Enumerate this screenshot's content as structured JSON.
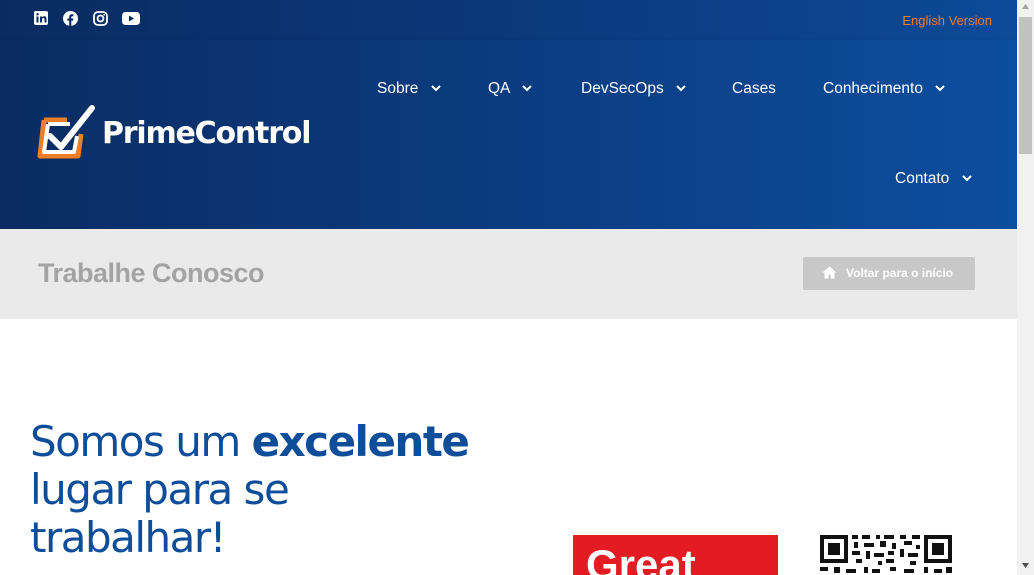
{
  "topbar": {
    "social_icons": [
      "linkedin-icon",
      "facebook-icon",
      "instagram-icon",
      "youtube-icon"
    ],
    "language_link": "English Version"
  },
  "header": {
    "logo_text": "PrimeControl",
    "nav": [
      {
        "label": "Sobre",
        "has_dropdown": true
      },
      {
        "label": "QA",
        "has_dropdown": true
      },
      {
        "label": "DevSecOps",
        "has_dropdown": true
      },
      {
        "label": "Cases",
        "has_dropdown": false
      },
      {
        "label": "Conhecimento",
        "has_dropdown": true
      },
      {
        "label": "Contato",
        "has_dropdown": true
      }
    ]
  },
  "titlebar": {
    "title": "Trabalhe Conosco",
    "back_button": "Voltar para o início"
  },
  "hero": {
    "headline_part1": "Somos um ",
    "headline_bold": "excelente",
    "headline_part2": "lugar para se",
    "headline_part3": "trabalhar!"
  },
  "badge": {
    "text": "Great"
  },
  "colors": {
    "brand_blue": "#0d4d99",
    "accent_orange": "#f07e26",
    "badge_red": "#e31b23",
    "titlebar_gray": "#eaeaea"
  }
}
